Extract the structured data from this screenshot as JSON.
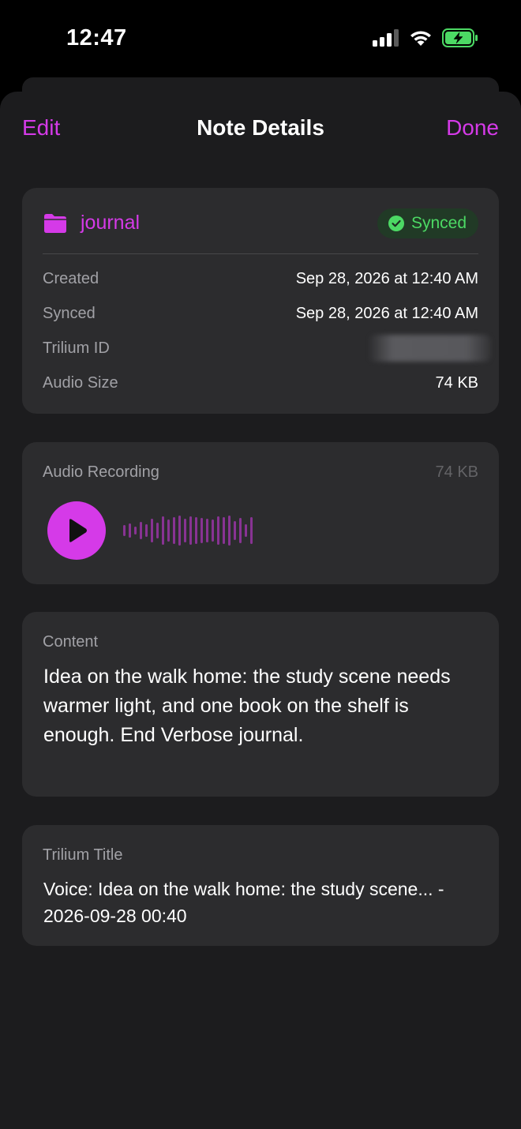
{
  "status_bar": {
    "time": "12:47"
  },
  "nav": {
    "edit_label": "Edit",
    "title": "Note Details",
    "done_label": "Done"
  },
  "info": {
    "folder": "journal",
    "status_badge": "Synced",
    "rows": [
      {
        "label": "Created",
        "value": "Sep 28, 2026 at 12:40 AM"
      },
      {
        "label": "Synced",
        "value": "Sep 28, 2026 at 12:40 AM"
      },
      {
        "label": "Trilium ID",
        "value": ""
      },
      {
        "label": "Audio Size",
        "value": "74 KB"
      }
    ]
  },
  "audio": {
    "label": "Audio Recording",
    "size": "74 KB"
  },
  "content": {
    "label": "Content",
    "text": "Idea on the walk home: the study scene needs warmer light, and one book on the shelf is enough. End Verbose journal."
  },
  "trilium_title": {
    "label": "Trilium Title",
    "text": "Voice: Idea on the walk home: the study scene... - 2026-09-28 00:40"
  },
  "colors": {
    "accent": "#d53ae8",
    "synced": "#4cd964",
    "card": "#2c2c2e",
    "sheet": "#1c1c1e"
  },
  "icons": [
    "cellular-signal-icon",
    "wifi-icon",
    "battery-charging-icon",
    "folder-icon",
    "checkmark-circle-icon",
    "play-icon",
    "waveform-icon"
  ]
}
